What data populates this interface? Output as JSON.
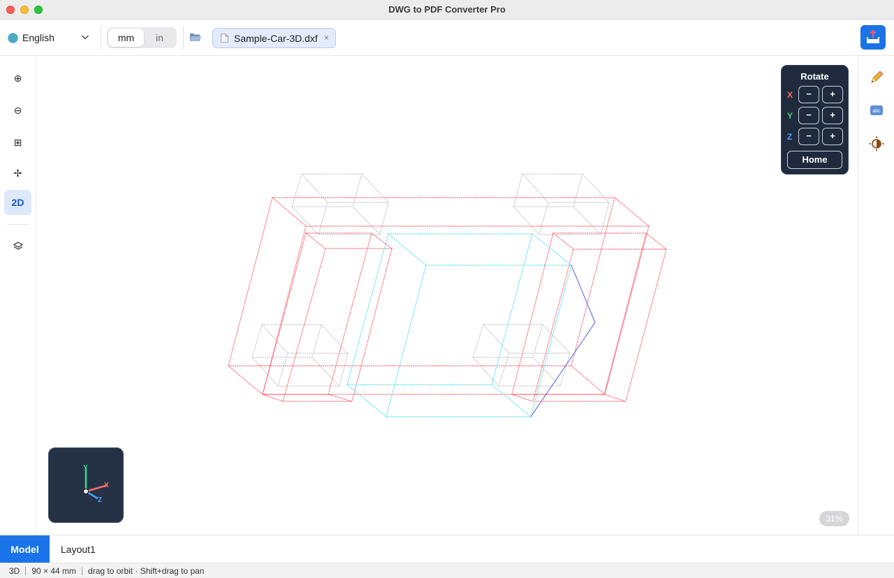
{
  "window": {
    "title": "DWG to PDF Converter Pro"
  },
  "toolbar": {
    "language": "English",
    "units": [
      "mm",
      "in"
    ],
    "active_unit": "mm",
    "file_tab": "Sample-Car-3D.dxf",
    "close_glyph": "×"
  },
  "leftbar": {
    "items": [
      {
        "name": "zoom-in",
        "glyph": "⊕"
      },
      {
        "name": "zoom-out",
        "glyph": "⊖"
      },
      {
        "name": "zoom-extents",
        "glyph": "⊞"
      },
      {
        "name": "pan",
        "glyph": "✢"
      },
      {
        "name": "view-mode",
        "label": "2D"
      },
      {
        "name": "layers",
        "glyph": "layers-icon"
      }
    ]
  },
  "rightbar": {
    "items": [
      "pencil-icon",
      "text-abc-icon",
      "contrast-icon"
    ]
  },
  "rotate": {
    "title": "Rotate",
    "axes": [
      {
        "label": "X",
        "color": "#ff6b6b"
      },
      {
        "label": "Y",
        "color": "#3ddc84"
      },
      {
        "label": "Z",
        "color": "#4aa3ff"
      }
    ],
    "minus": "−",
    "plus": "+",
    "home": "Home"
  },
  "gizmo": {
    "x": "X",
    "y": "Y",
    "z": "Z"
  },
  "zoom": "31%",
  "tabs": [
    "Model",
    "Layout1"
  ],
  "status": {
    "mode": "3D",
    "size": "90 × 44 mm",
    "hint": "drag to orbit · Shift+drag to pan"
  },
  "colors": {
    "accent": "#1a73e8",
    "wire_red": "#ff4d5e",
    "wire_cyan": "#3ee0ea",
    "wire_gray": "#b0b0b0",
    "wire_blue": "#5560e8"
  }
}
